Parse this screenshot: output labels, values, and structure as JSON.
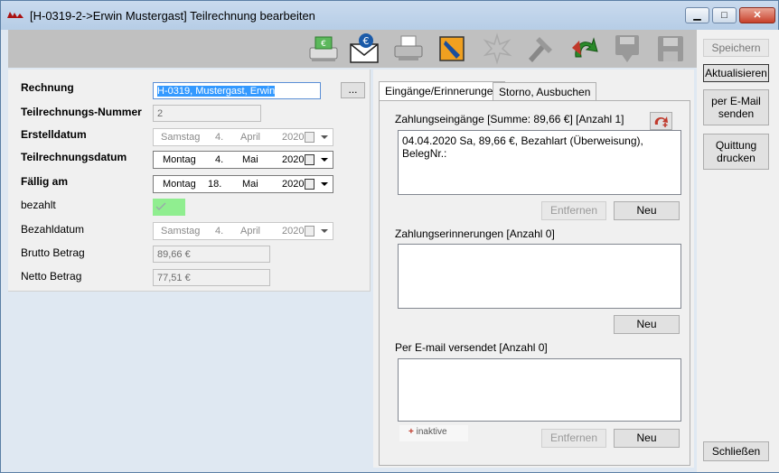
{
  "window": {
    "title": "[H-0319-2->Erwin Mustergast] Teilrechnung bearbeiten",
    "min_label": "▁",
    "max_label": "□",
    "close_label": "✕"
  },
  "toolbar": {
    "icons": [
      "print-money-icon",
      "email-euro-icon",
      "printer-icon",
      "edit-document-icon",
      "burst-icon",
      "tools-icon",
      "undo-arrow-icon",
      "save-down-icon",
      "save-icon"
    ]
  },
  "form": {
    "rechnung_label": "Rechnung",
    "rechnung_value": "H-0319, Mustergast, Erwin",
    "browse_label": "...",
    "teilnr_label": "Teilrechnungs-Nummer",
    "teilnr_value": "2",
    "erstell_label": "Erstelldatum",
    "erstell": {
      "weekday": "Samstag",
      "day": "4.",
      "month": "April",
      "year": "2020"
    },
    "teildatum_label": "Teilrechnungsdatum",
    "teildatum": {
      "weekday": "Montag",
      "day": "4.",
      "month": "Mai",
      "year": "2020"
    },
    "faellig_label": "Fällig am",
    "faellig": {
      "weekday": "Montag",
      "day": "18.",
      "month": "Mai",
      "year": "2020"
    },
    "bezahlt_label": "bezahlt",
    "bezahlt_checked": true,
    "bezahldatum_label": "Bezahldatum",
    "bezahldatum": {
      "weekday": "Samstag",
      "day": "4.",
      "month": "April",
      "year": "2020"
    },
    "brutto_label": "Brutto Betrag",
    "brutto_value": "89,66 €",
    "netto_label": "Netto Betrag",
    "netto_value": "77,51 €"
  },
  "tabs": [
    {
      "label": "Eingänge/Erinnerungen",
      "active": true
    },
    {
      "label": "Storno, Ausbuchen",
      "active": false
    }
  ],
  "payments": {
    "title": "Zahlungseingänge [Summe: 89,66 €] [Anzahl 1]",
    "items": [
      "04.04.2020 Sa, 89,66 €, Bezahlart (Überweisung), BelegNr.:"
    ],
    "remove_label": "Entfernen",
    "new_label": "Neu"
  },
  "reminders": {
    "title": "Zahlungserinnerungen [Anzahl 0]",
    "new_label": "Neu"
  },
  "emails": {
    "title": "Per E-mail versendet [Anzahl 0]",
    "inactive_label": "inaktive",
    "remove_label": "Entfernen",
    "new_label": "Neu"
  },
  "sidebar": {
    "save_label": "Speichern",
    "refresh_label": "Aktualisieren",
    "email_label_1": "per E-Mail",
    "email_label_2": "senden",
    "receipt_label_1": "Quittung",
    "receipt_label_2": "drucken",
    "close_label": "Schließen"
  },
  "colors": {
    "checkbox_bg": "#90ee90",
    "titlebar": "#b6cde6",
    "toolbar": "#c0c0c0",
    "accent_red": "#c0392b"
  }
}
